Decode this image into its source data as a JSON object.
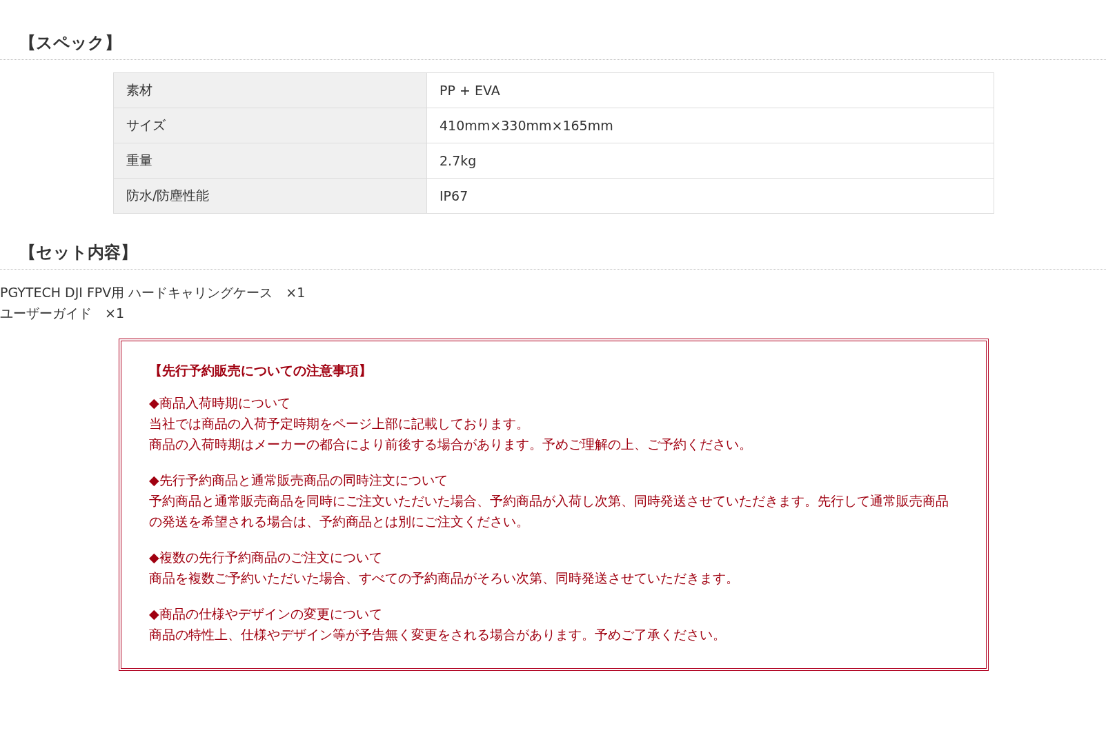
{
  "spec": {
    "heading": "【スペック】",
    "rows": [
      {
        "label": "素材",
        "value": "PP + EVA"
      },
      {
        "label": "サイズ",
        "value": "410mm×330mm×165mm"
      },
      {
        "label": "重量",
        "value": "2.7kg"
      },
      {
        "label": "防水/防塵性能",
        "value": "IP67"
      }
    ]
  },
  "set_contents": {
    "heading": "【セット内容】",
    "items": [
      "PGYTECH DJI FPV用 ハードキャリングケース　×1",
      "ユーザーガイド　×1"
    ]
  },
  "notice": {
    "title": "【先行予約販売についての注意事項】",
    "blocks": [
      {
        "heading": "◆商品入荷時期について",
        "lines": [
          "当社では商品の入荷予定時期をページ上部に記載しております。",
          "商品の入荷時期はメーカーの都合により前後する場合があります。予めご理解の上、ご予約ください。"
        ]
      },
      {
        "heading": "◆先行予約商品と通常販売商品の同時注文について",
        "lines": [
          "予約商品と通常販売商品を同時にご注文いただいた場合、予約商品が入荷し次第、同時発送させていただきます。先行して通常販売商品の発送を希望される場合は、予約商品とは別にご注文ください。"
        ]
      },
      {
        "heading": "◆複数の先行予約商品のご注文について",
        "lines": [
          "商品を複数ご予約いただいた場合、すべての予約商品がそろい次第、同時発送させていただきます。"
        ]
      },
      {
        "heading": "◆商品の仕様やデザインの変更について",
        "lines": [
          "商品の特性上、仕様やデザイン等が予告無く変更をされる場合があります。予めご了承ください。"
        ]
      }
    ]
  }
}
